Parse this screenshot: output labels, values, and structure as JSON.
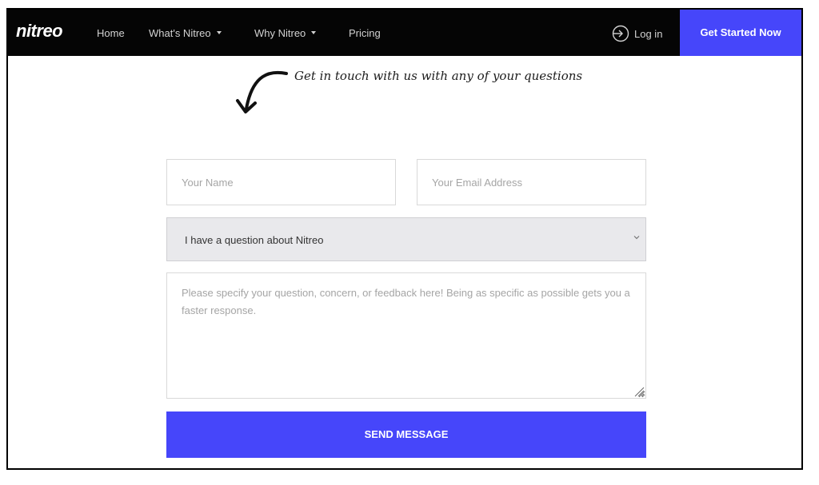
{
  "nav": {
    "logo": "nitreo",
    "items": [
      {
        "label": "Home"
      },
      {
        "label": "What's Nitreo",
        "dropdown": true
      },
      {
        "label": "Why Nitreo",
        "dropdown": true
      },
      {
        "label": "Pricing"
      }
    ],
    "login_label": "Log in",
    "login_icon": "login-icon",
    "cta_label": "Get Started Now"
  },
  "hero": {
    "tagline": "Get in touch with us with any of your questions",
    "arrow_icon": "curved-arrow-icon"
  },
  "form": {
    "name_placeholder": "Your Name",
    "email_placeholder": "Your Email Address",
    "topic_selected": "I have a question about Nitreo",
    "message_placeholder": "Please specify your question, concern, or feedback here! Being as specific as possible gets you a faster response.",
    "send_label": "SEND MESSAGE"
  },
  "colors": {
    "nav_bg": "#050505",
    "accent": "#4646fa",
    "select_bg": "#e9e9ec"
  }
}
